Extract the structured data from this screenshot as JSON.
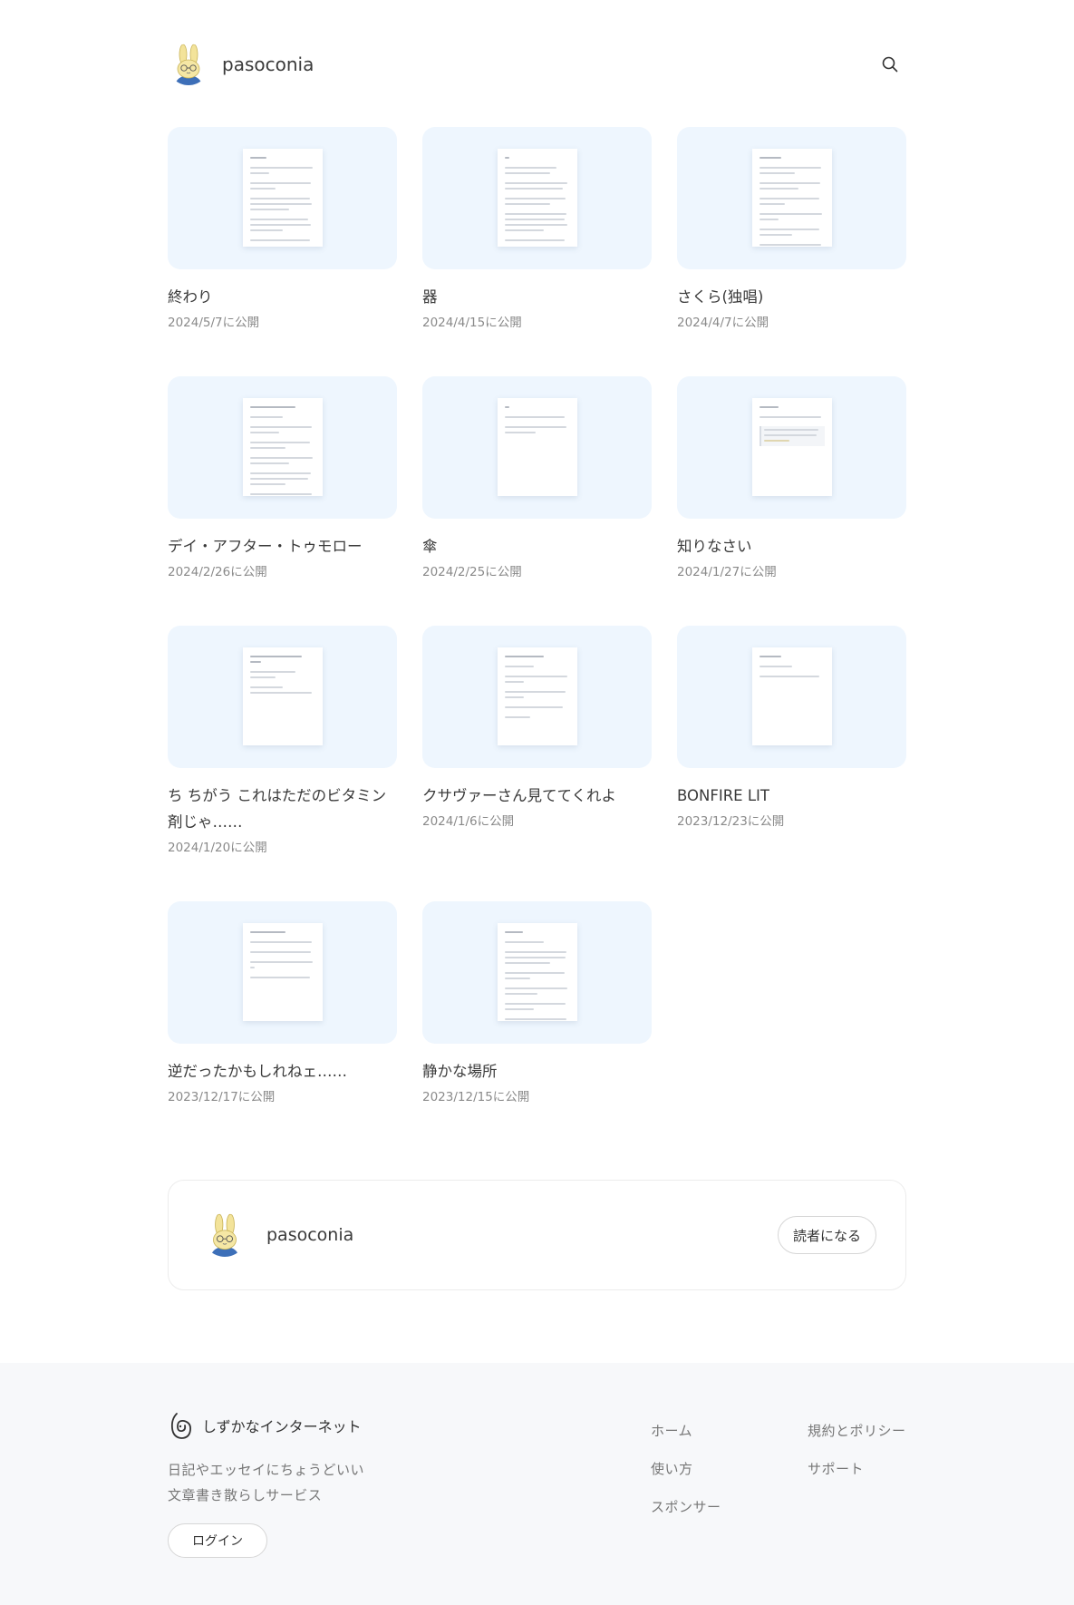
{
  "header": {
    "site_name": "pasoconia",
    "search_icon": "search-icon",
    "avatar_icon": "rabbit-avatar"
  },
  "colors": {
    "thumb_bg": "#eef6fe",
    "footer_bg": "#f7f8fa",
    "text": "#3a3a3a",
    "muted": "#8a8a8a"
  },
  "posts": [
    {
      "title": "終わり",
      "date": "2024/5/7に公開"
    },
    {
      "title": "器",
      "date": "2024/4/15に公開"
    },
    {
      "title": "さくら(独唱)",
      "date": "2024/4/7に公開"
    },
    {
      "title": "デイ・アフター・トゥモロー",
      "date": "2024/2/26に公開"
    },
    {
      "title": "傘",
      "date": "2024/2/25に公開"
    },
    {
      "title": "知りなさい",
      "date": "2024/1/27に公開"
    },
    {
      "title": "ち ちがう これはただのビタミン剤じゃ……",
      "date": "2024/1/20に公開"
    },
    {
      "title": "クサヴァーさん見ててくれよ",
      "date": "2024/1/6に公開"
    },
    {
      "title": "BONFIRE LIT",
      "date": "2023/12/23に公開"
    },
    {
      "title": "逆だったかもしれねェ……",
      "date": "2023/12/17に公開"
    },
    {
      "title": "静かな場所",
      "date": "2023/12/15に公開"
    }
  ],
  "author": {
    "name": "pasoconia",
    "follow_label": "読者になる"
  },
  "footer": {
    "logo_icon": "shizuka-logo",
    "brand": "しずかなインターネット",
    "desc_line1": "日記やエッセイにちょうどいい",
    "desc_line2": "文章書き散らしサービス",
    "login_label": "ログイン",
    "links_col1": [
      "ホーム",
      "使い方",
      "スポンサー"
    ],
    "links_col2": [
      "規約とポリシー",
      "サポート"
    ]
  }
}
